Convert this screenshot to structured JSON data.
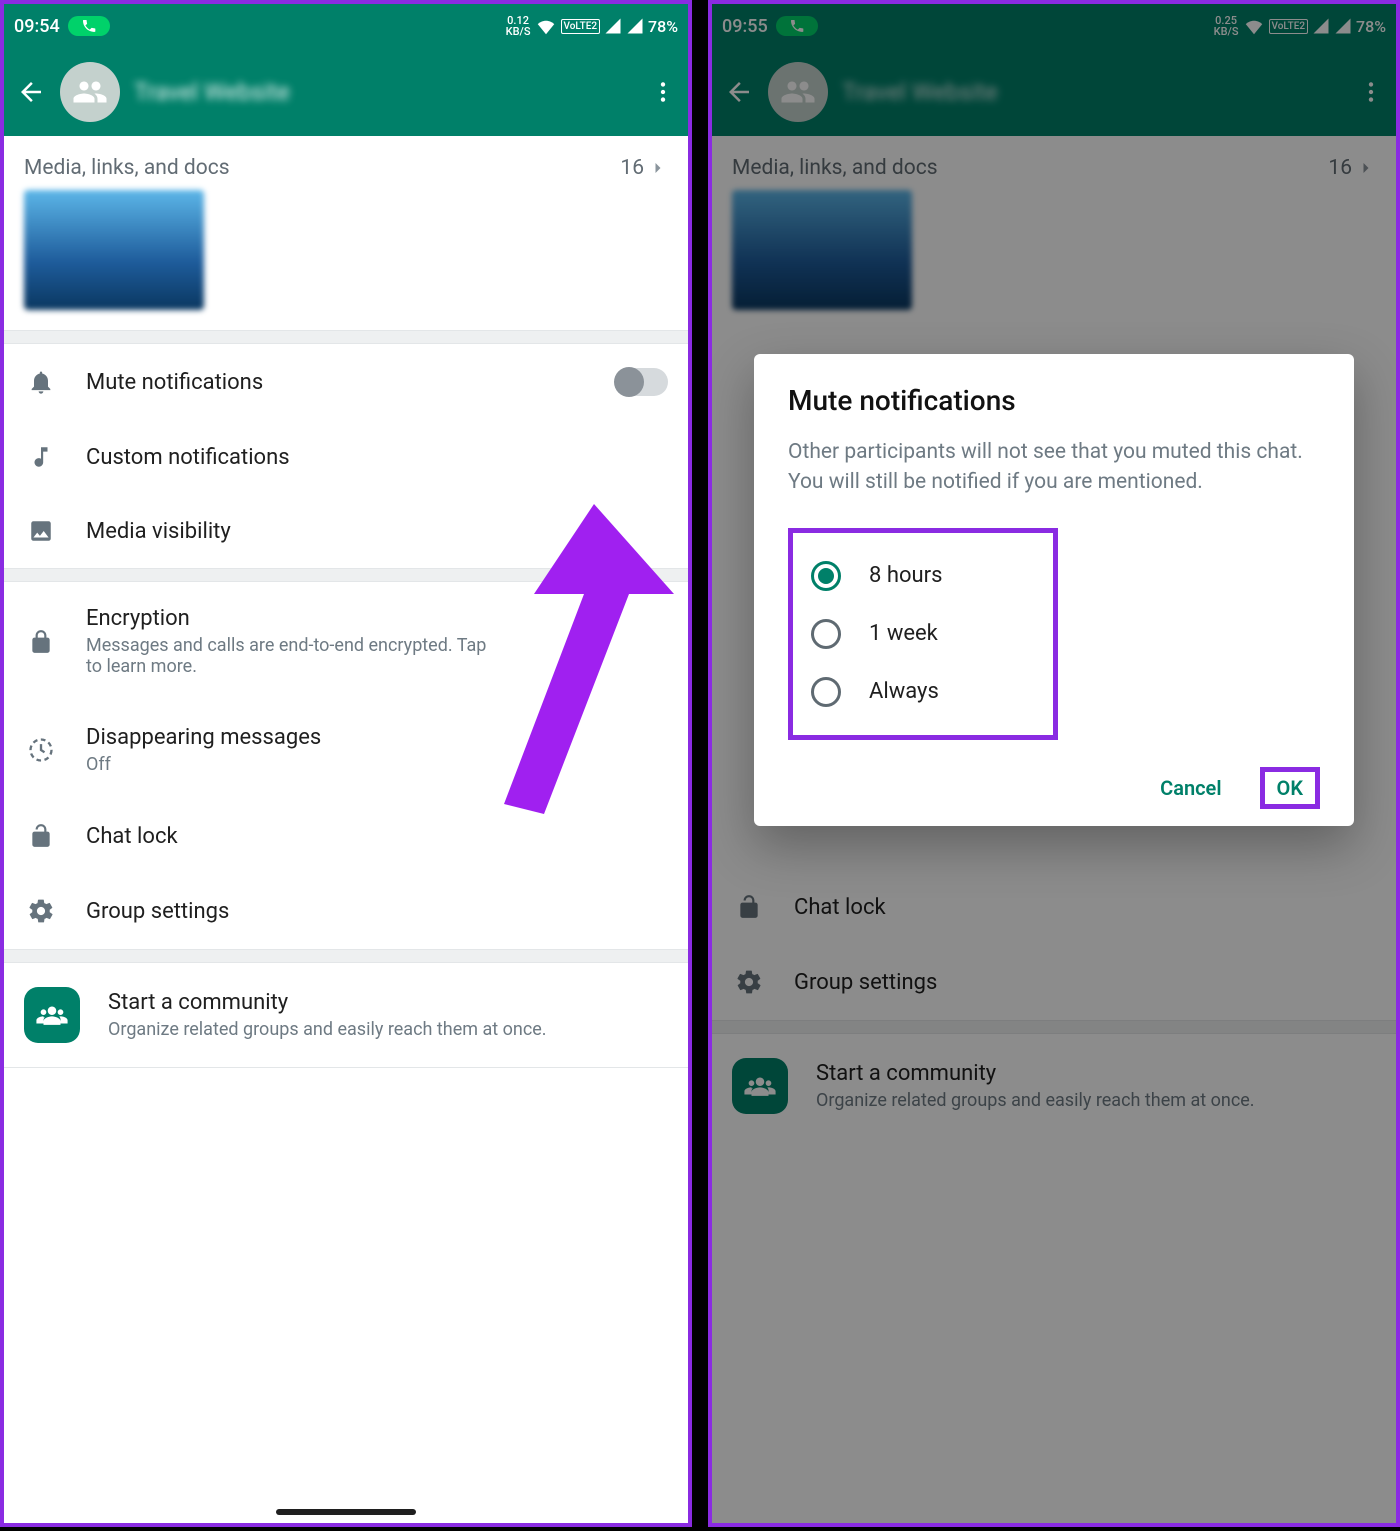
{
  "left": {
    "status": {
      "time": "09:54",
      "kbs": "0.12",
      "kbs_unit": "KB/S",
      "lte": "VoLTE2",
      "battery": "78%"
    },
    "group_title": "Travel Website",
    "media": {
      "label": "Media, links, and docs",
      "count": "16"
    },
    "rows": {
      "mute": "Mute notifications",
      "custom": "Custom notifications",
      "media_vis": "Media visibility",
      "enc_title": "Encryption",
      "enc_sub": "Messages and calls are end-to-end encrypted. Tap to learn more.",
      "disap_title": "Disappearing messages",
      "disap_sub": "Off",
      "chat_lock": "Chat lock",
      "group_settings": "Group settings",
      "community_title": "Start a community",
      "community_sub": "Organize related groups and easily reach them at once."
    }
  },
  "right": {
    "status": {
      "time": "09:55",
      "kbs": "0.25",
      "kbs_unit": "KB/S",
      "lte": "VoLTE2",
      "battery": "78%"
    },
    "group_title": "Travel Website",
    "media": {
      "label": "Media, links, and docs",
      "count": "16"
    },
    "rows": {
      "chat_lock": "Chat lock",
      "group_settings": "Group settings",
      "community_title": "Start a community",
      "community_sub": "Organize related groups and easily reach them at once."
    },
    "dialog": {
      "title": "Mute notifications",
      "body": "Other participants will not see that you muted this chat. You will still be notified if you are mentioned.",
      "options": {
        "o1": "8 hours",
        "o2": "1 week",
        "o3": "Always"
      },
      "cancel": "Cancel",
      "ok": "OK"
    }
  }
}
